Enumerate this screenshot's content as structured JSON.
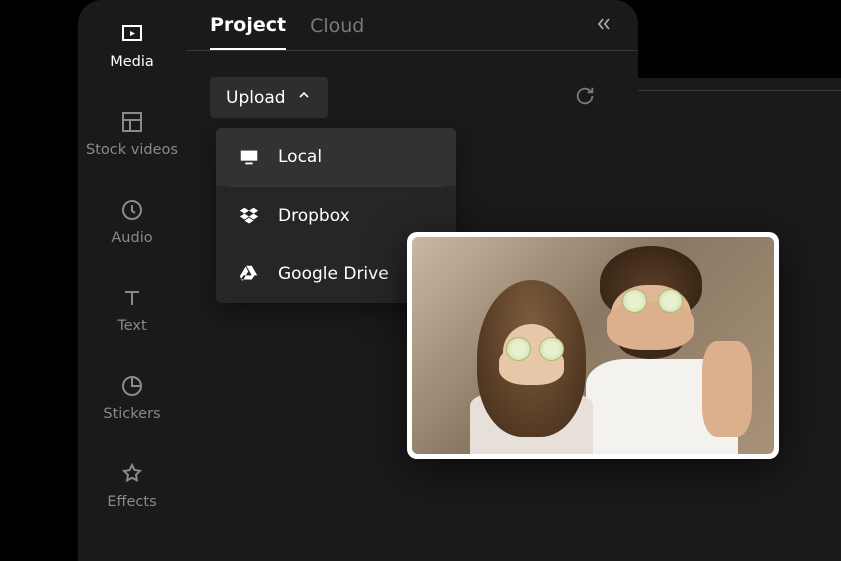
{
  "sidebar": {
    "items": [
      {
        "label": "Media"
      },
      {
        "label": "Stock videos"
      },
      {
        "label": "Audio"
      },
      {
        "label": "Text"
      },
      {
        "label": "Stickers"
      },
      {
        "label": "Effects"
      }
    ]
  },
  "panel": {
    "tabs": {
      "project": "Project",
      "cloud": "Cloud"
    },
    "upload_button": "Upload",
    "dropdown": {
      "local": "Local",
      "dropbox": "Dropbox",
      "google_drive": "Google Drive"
    }
  }
}
